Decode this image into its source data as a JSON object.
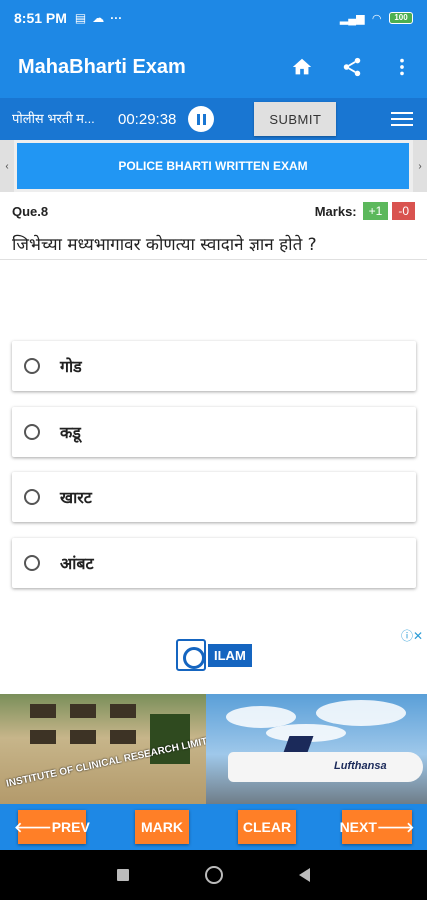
{
  "status_bar": {
    "time": "8:51 PM",
    "battery": "100"
  },
  "app_bar": {
    "title": "MahaBharti Exam"
  },
  "exam_bar": {
    "exam_name": "पोलीस भरती म...",
    "timer": "00:29:38",
    "submit_label": "SUBMIT"
  },
  "section": {
    "title": "POLICE BHARTI WRITTEN EXAM",
    "prev_arrow": "‹",
    "next_arrow": "›"
  },
  "question": {
    "number": "Que.8",
    "marks_label": "Marks:",
    "marks_plus": "+1",
    "marks_minus": "-0",
    "text": "जिभेच्या मध्यभागावर कोणत्या स्वादाने ज्ञान होते ?",
    "options": [
      "गोड",
      "कडू",
      "खारट",
      "आंबट"
    ]
  },
  "ads": {
    "logo_text": "ILAM",
    "banner_text": "INSTITUTE OF CLINICAL RESEARCH LIMITED",
    "airline_text": "Lufthansa"
  },
  "bottom_bar": {
    "prev_label": "🡐PREV",
    "mark_label": "MARK",
    "clear_label": "CLEAR",
    "next_label": "NEXT🡒"
  },
  "colors": {
    "primary": "#1e88e5",
    "accent": "#ff7f27",
    "marks_plus": "#5cb85c",
    "marks_minus": "#d9534f"
  }
}
